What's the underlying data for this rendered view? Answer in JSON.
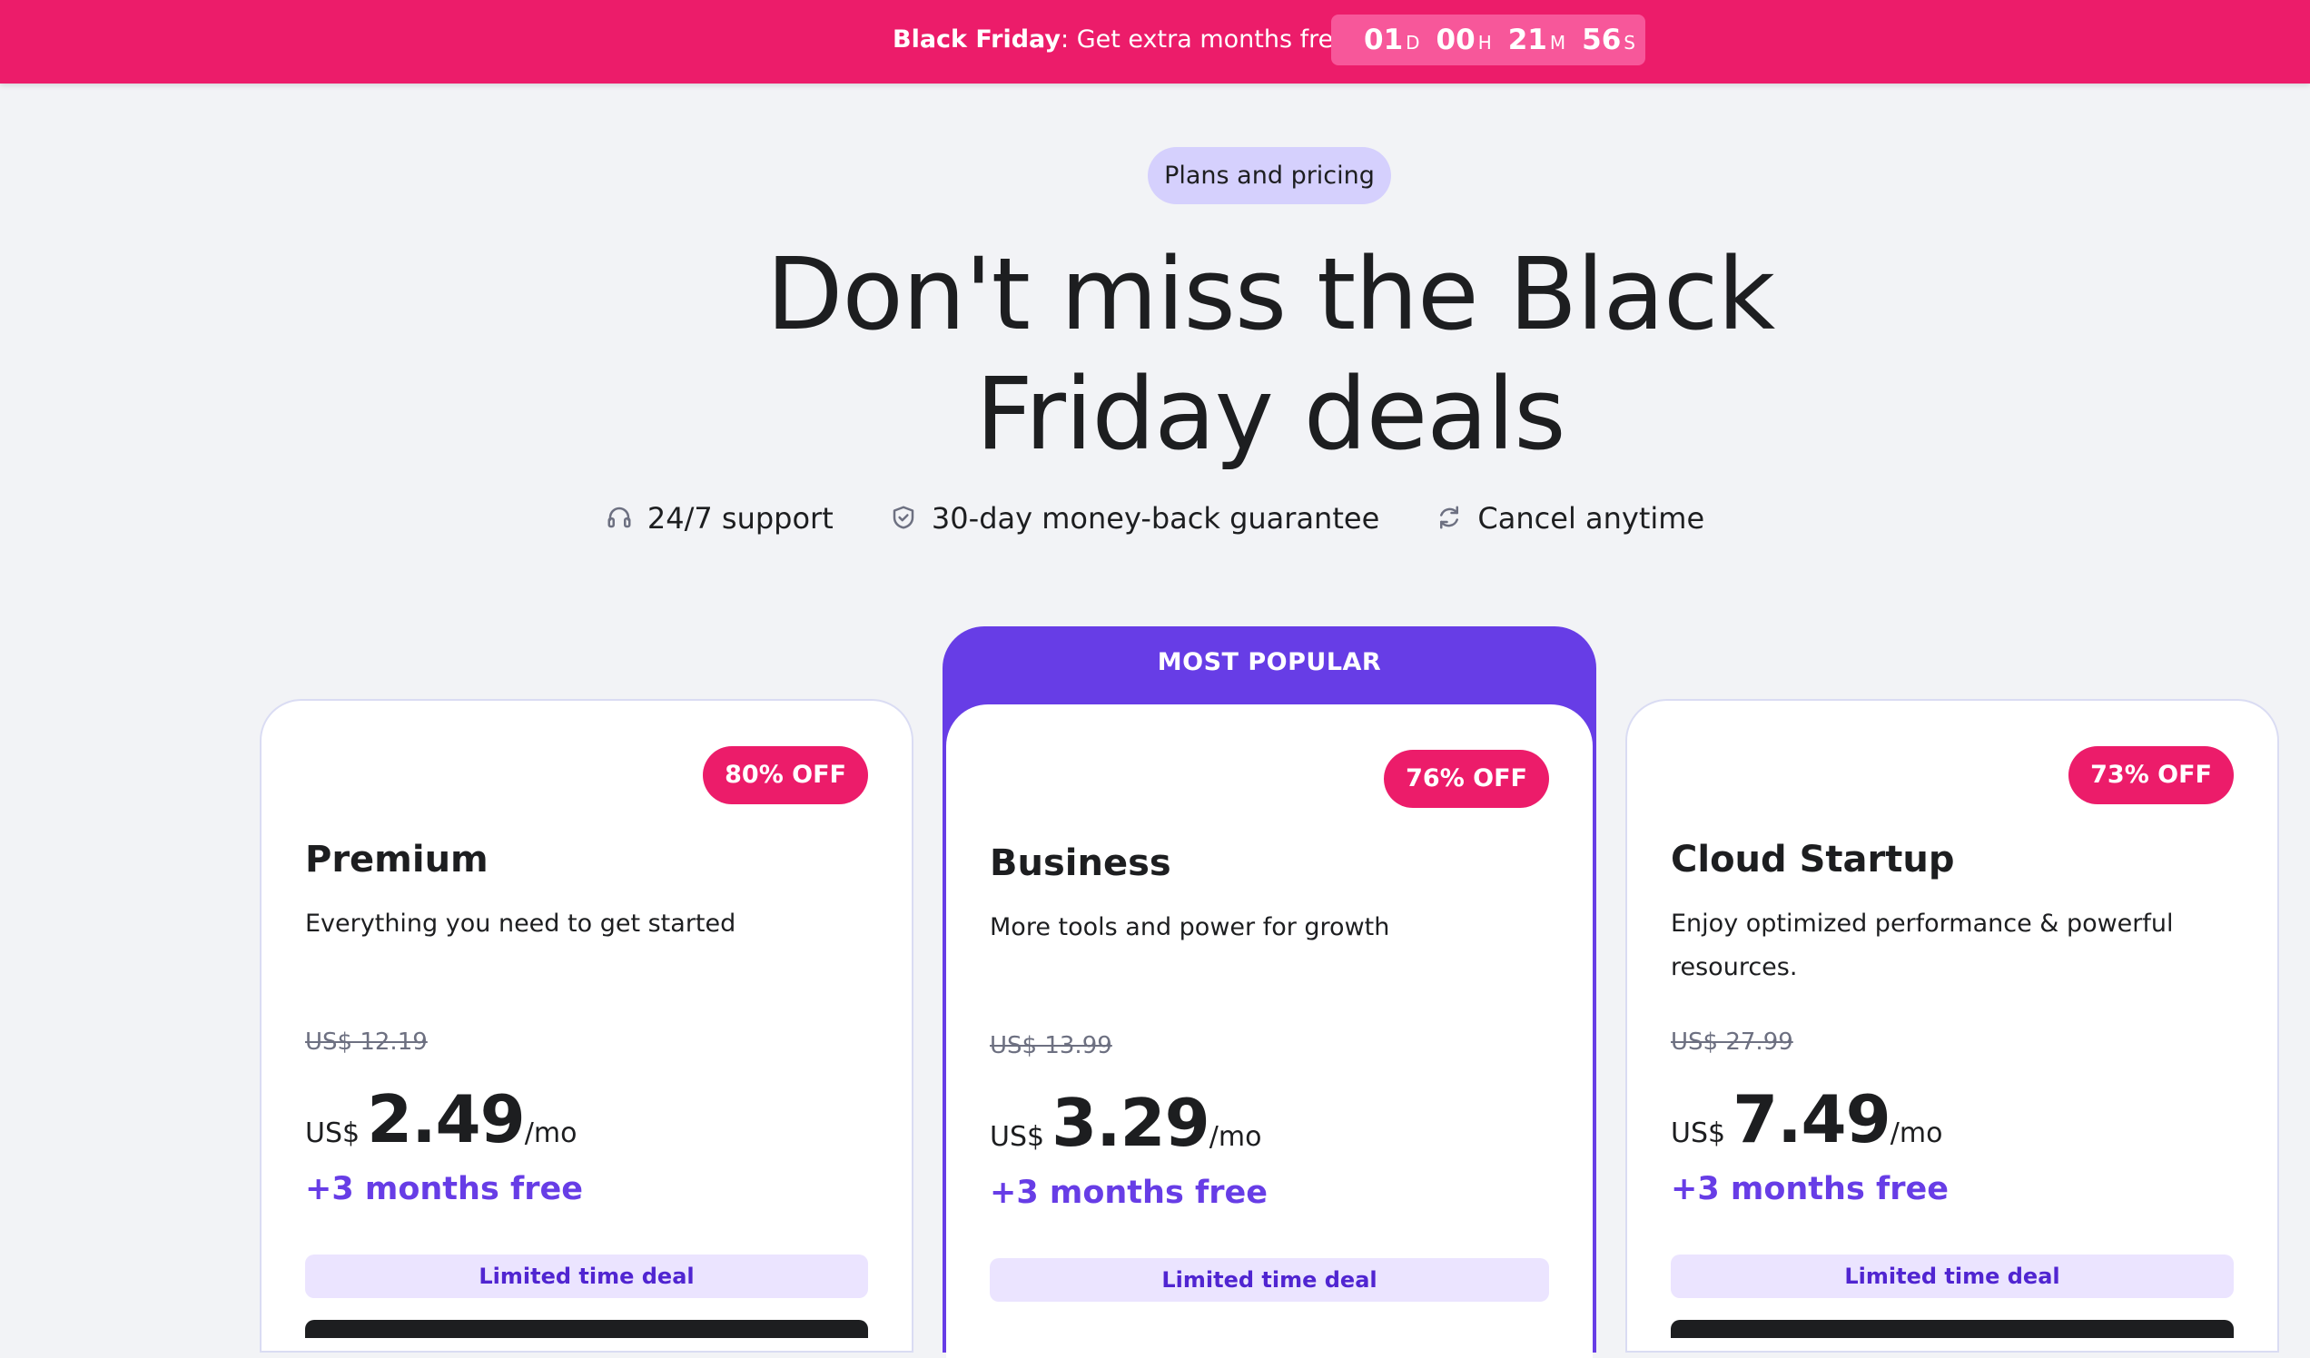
{
  "banner": {
    "bold": "Black Friday",
    "text": ": Get extra months free",
    "countdown": {
      "days": "01",
      "days_unit": "D",
      "hours": "00",
      "hours_unit": "H",
      "minutes": "21",
      "minutes_unit": "M",
      "seconds": "56",
      "seconds_unit": "S"
    }
  },
  "hero": {
    "pill": "Plans and pricing",
    "headline_line1": "Don't miss the Black",
    "headline_line2": "Friday deals",
    "features": [
      {
        "icon": "headset-icon",
        "label": "24/7 support"
      },
      {
        "icon": "shield-check-icon",
        "label": "30-day money-back guarantee"
      },
      {
        "icon": "refresh-icon",
        "label": "Cancel anytime"
      }
    ]
  },
  "plans": [
    {
      "discount": "80% OFF",
      "name": "Premium",
      "description": "Everything you need to get started",
      "old_price": "US$ 12.19",
      "currency": "US$",
      "price": "2.49",
      "period": "/mo",
      "bonus": "+3 months free",
      "deal": "Limited time deal"
    },
    {
      "ribbon": "MOST POPULAR",
      "discount": "76% OFF",
      "name": "Business",
      "description": "More tools and power for growth",
      "old_price": "US$ 13.99",
      "currency": "US$",
      "price": "3.29",
      "period": "/mo",
      "bonus": "+3 months free",
      "deal": "Limited time deal"
    },
    {
      "discount": "73% OFF",
      "name": "Cloud Startup",
      "description": "Enjoy optimized performance & powerful resources.",
      "old_price": "US$ 27.99",
      "currency": "US$",
      "price": "7.49",
      "period": "/mo",
      "bonus": "+3 months free",
      "deal": "Limited time deal"
    }
  ],
  "colors": {
    "banner": "#ec1c6a",
    "countdown_bg": "#f7579a",
    "accent": "#673de6",
    "badge": "#ec1c6a",
    "pill": "#d5d0fd",
    "deal_bg": "#ebe4ff",
    "page_bg": "#f2f3f6"
  }
}
